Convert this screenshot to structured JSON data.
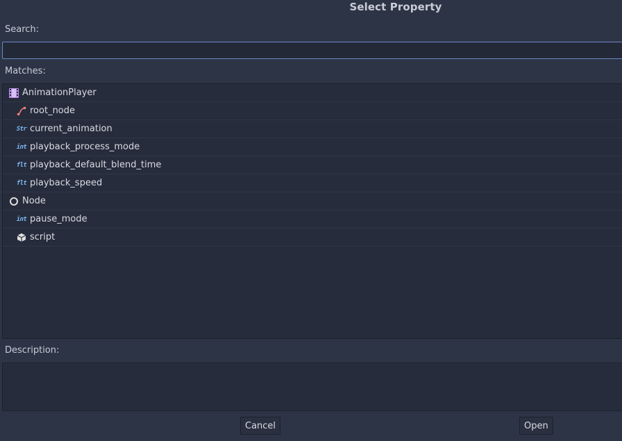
{
  "dialog": {
    "title": "Select Property",
    "search_label": "Search:",
    "search_value": "",
    "matches_label": "Matches:",
    "description_label": "Description:",
    "description_text": "",
    "cancel_label": "Cancel",
    "open_label": "Open"
  },
  "tree": [
    {
      "label": "AnimationPlayer",
      "level": 0,
      "icon": "animation-player-icon"
    },
    {
      "label": "root_node",
      "level": 1,
      "icon": "node-path-icon"
    },
    {
      "label": "current_animation",
      "level": 1,
      "icon": "str-type-icon",
      "type_text": "Str"
    },
    {
      "label": "playback_process_mode",
      "level": 1,
      "icon": "int-type-icon",
      "type_text": "int"
    },
    {
      "label": "playback_default_blend_time",
      "level": 1,
      "icon": "float-type-icon",
      "type_text": "flt"
    },
    {
      "label": "playback_speed",
      "level": 1,
      "icon": "float-type-icon",
      "type_text": "flt"
    },
    {
      "label": "Node",
      "level": 0,
      "icon": "node-icon"
    },
    {
      "label": "pause_mode",
      "level": 1,
      "icon": "int-type-icon",
      "type_text": "int"
    },
    {
      "label": "script",
      "level": 1,
      "icon": "script-cube-icon"
    }
  ],
  "colors": {
    "animation_player_icon": "#b98ee8",
    "node_path_icon": "#f08080",
    "type_icon": "#7db7f0",
    "node_icon": "#e0e0e0",
    "script_icon": "#e0e0e0"
  }
}
